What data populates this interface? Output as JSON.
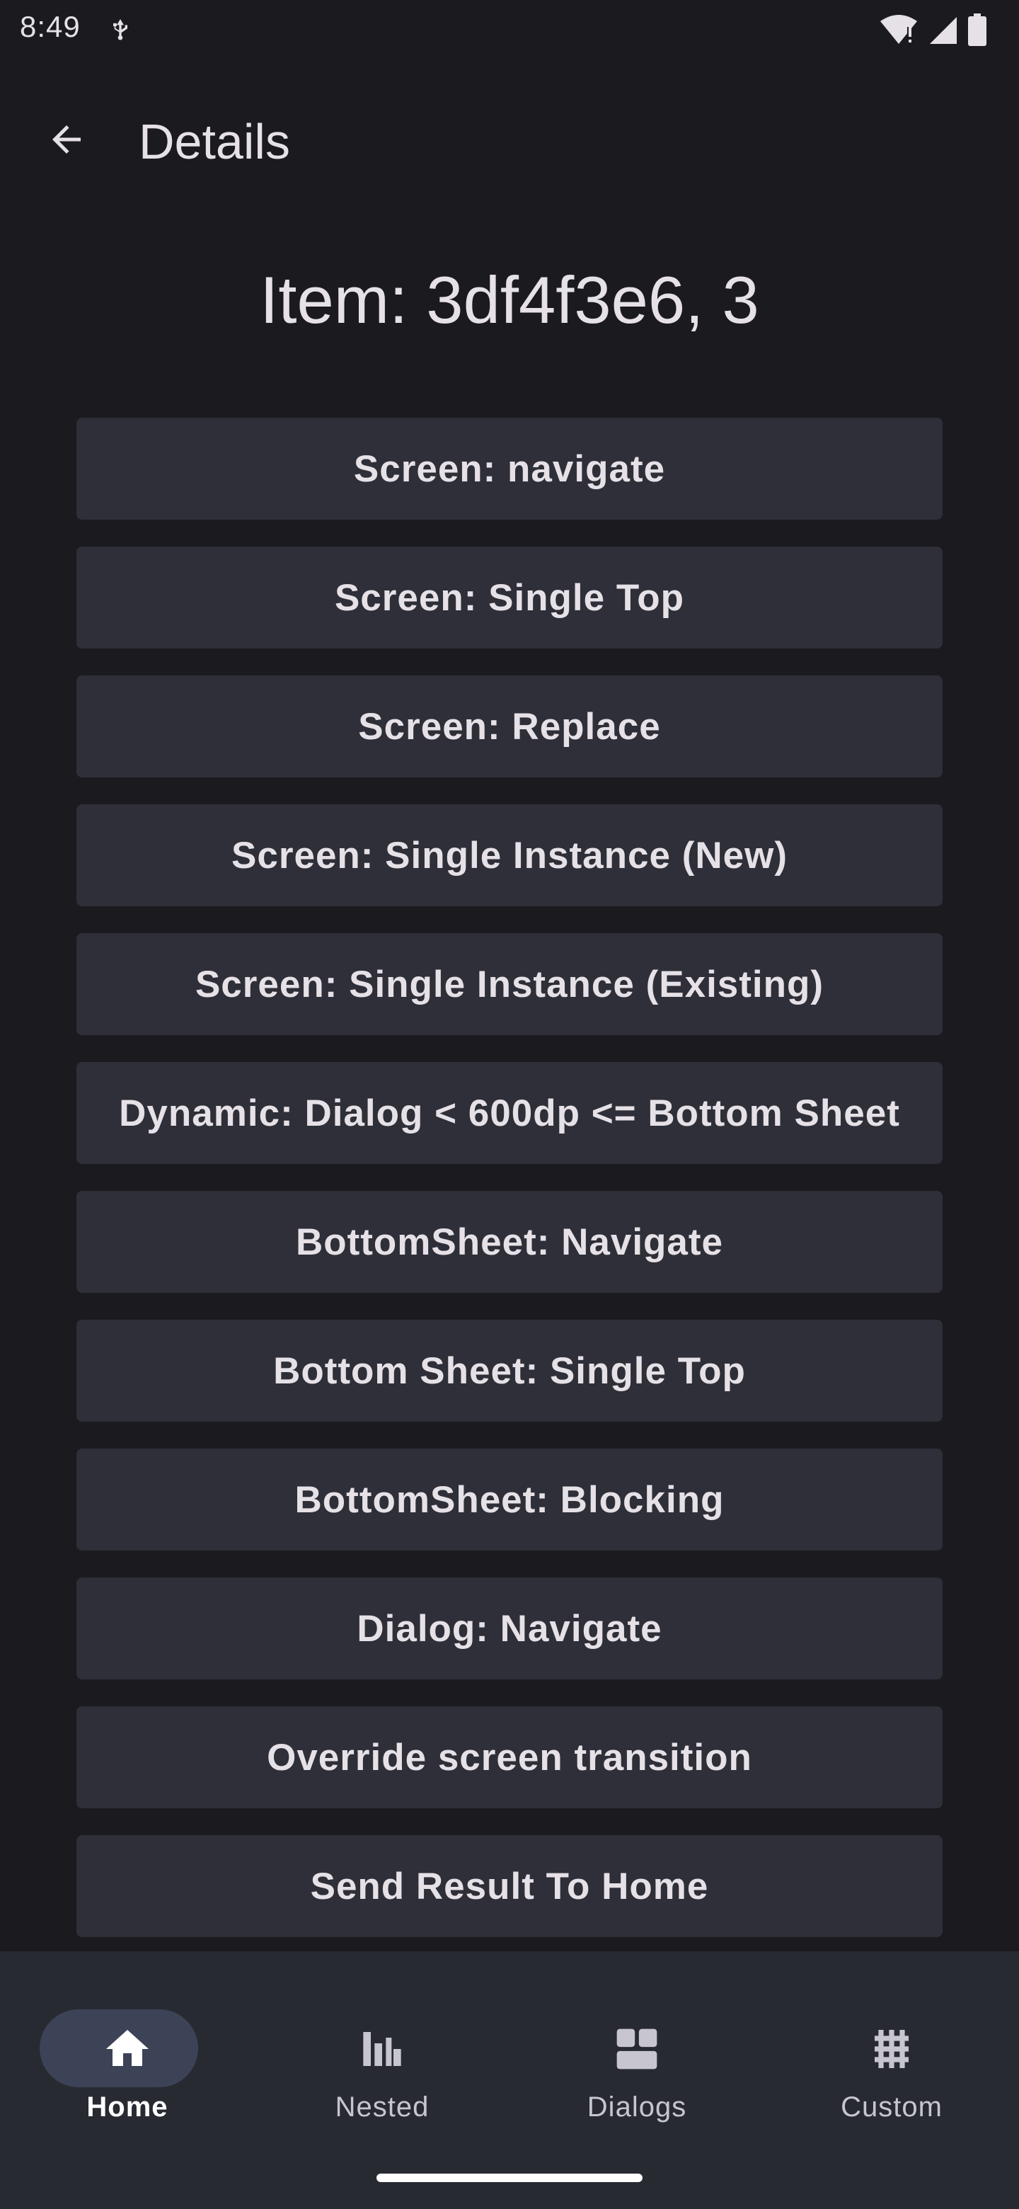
{
  "status_bar": {
    "time": "8:49"
  },
  "top_bar": {
    "title": "Details"
  },
  "content": {
    "item_title": "Item: 3df4f3e6, 3",
    "buttons": [
      {
        "label": "Screen: navigate"
      },
      {
        "label": "Screen: Single Top"
      },
      {
        "label": "Screen: Replace"
      },
      {
        "label": "Screen: Single Instance (New)"
      },
      {
        "label": "Screen: Single Instance (Existing)"
      },
      {
        "label": "Dynamic: Dialog < 600dp <= Bottom Sheet"
      },
      {
        "label": "BottomSheet: Navigate"
      },
      {
        "label": "Bottom Sheet: Single Top"
      },
      {
        "label": "BottomSheet: Blocking"
      },
      {
        "label": "Dialog: Navigate"
      },
      {
        "label": "Override screen transition"
      },
      {
        "label": "Send Result To Home"
      }
    ]
  },
  "bottom_nav": {
    "selected": "Home",
    "items": [
      {
        "label": "Home",
        "icon": "home-icon"
      },
      {
        "label": "Nested",
        "icon": "nested-bars-icon"
      },
      {
        "label": "Dialogs",
        "icon": "grid-squares-icon"
      },
      {
        "label": "Custom",
        "icon": "hashtag-grid-icon"
      }
    ]
  },
  "colors": {
    "background": "#1b1b1f",
    "button_surface": "#2e2f38",
    "nav_surface": "#282a32",
    "nav_indicator": "#3d4356",
    "text": "#e6e1e6"
  }
}
